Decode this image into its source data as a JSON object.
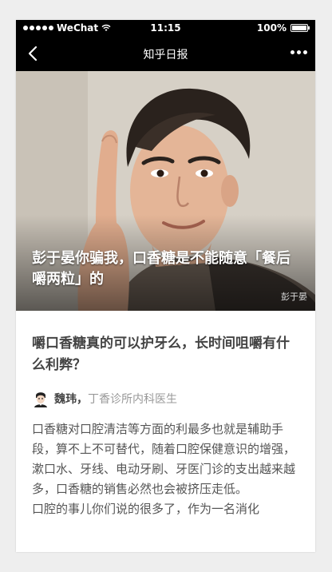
{
  "status_bar": {
    "carrier": "WeChat",
    "time": "11:15",
    "battery": "100%"
  },
  "nav": {
    "title": "知乎日报",
    "back_icon": "back-chevron-icon",
    "more_icon": "more-dots-icon"
  },
  "hero": {
    "title": "彭于晏你骗我，口香糖是不能随意「餐后嚼两粒」的",
    "credit": "彭于晏"
  },
  "question": {
    "title": "嚼口香糖真的可以护牙么，长时间咀嚼有什么利弊？"
  },
  "author": {
    "name": "魏玮，",
    "bio": "丁香诊所内科医生"
  },
  "body": {
    "paragraph_1": "口香糖对口腔清洁等方面的利最多也就是辅助手段，算不上不可替代，随着口腔保健意识的增强，漱口水、牙线、电动牙刷、牙医门诊的支出越来越多，口香糖的销售必然也会被挤压走低。",
    "paragraph_2": "口腔的事儿你们说的很多了，作为一名消化"
  }
}
